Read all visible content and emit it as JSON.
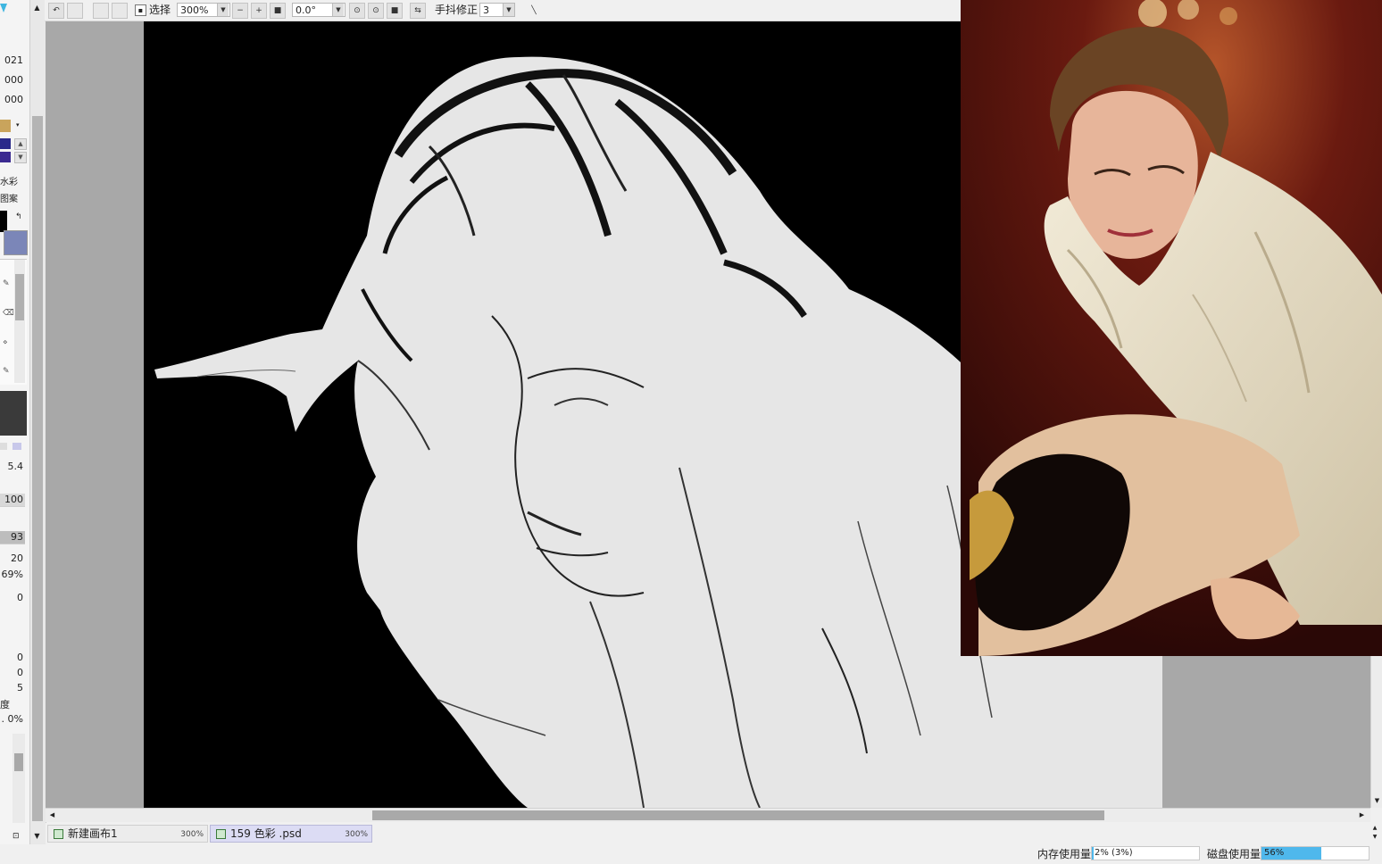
{
  "toolbar": {
    "selection_label": "选择",
    "zoom_value": "300%",
    "rotation_value": "0.0°",
    "stabilizer_label": "手抖修正",
    "stabilizer_value": "3"
  },
  "left_panel": {
    "color_values": [
      "021",
      "000",
      "000"
    ],
    "brush_types": [
      "水彩",
      "图案"
    ],
    "params": [
      "5.4",
      "100",
      "93",
      "20",
      "69%",
      "0",
      "0",
      "0",
      "5"
    ],
    "label_density": "度",
    "value_percent": ". 0%",
    "colors": {
      "gold": "#c9a45c",
      "navy": "#2a2a8a",
      "purple": "#3b2a90",
      "slate": "#7b86b8",
      "dark": "#3a3a3a"
    }
  },
  "tabs": [
    {
      "name": "新建画布1",
      "zoom": "300%",
      "active": false
    },
    {
      "name": "159 色彩 .psd",
      "zoom": "300%",
      "active": true
    }
  ],
  "status": {
    "memory_label": "内存使用量",
    "memory_value": "2% (3%)",
    "memory_fraction": 0.02,
    "disk_label": "磁盘使用量",
    "disk_value": "56%",
    "disk_fraction": 0.56,
    "accent": "#4fb8ec"
  }
}
